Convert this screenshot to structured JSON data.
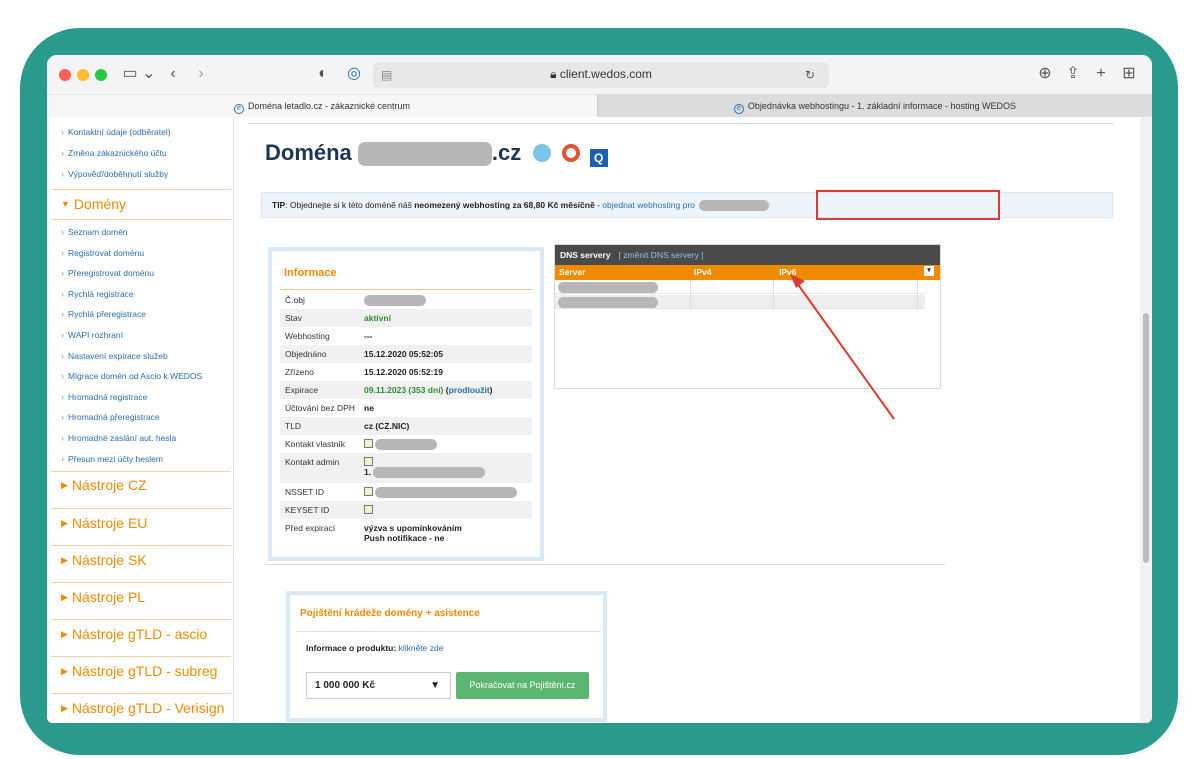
{
  "browser": {
    "url": "client.wedos.com",
    "tabs": [
      {
        "label": "Doména letadlo.cz - zákaznické centrum"
      },
      {
        "label": "Objednávka webhostingu - 1. základní informace - hosting WEDOS"
      }
    ]
  },
  "sidebar": {
    "top_links": [
      "Kontaktní údaje (odběratel)",
      "Změna zákaznického účtu",
      "Výpověď/doběhnutí služby"
    ],
    "domains_section": "Domény",
    "domain_links": [
      "Seznam domén",
      "Registrovat doménu",
      "Přeregistrovat doménu",
      "Rychlá registrace",
      "Rychlá přeregistrace",
      "WAPI rozhraní",
      "Nastavení expirace služeb",
      "Migrace domén od Ascio k WEDOS",
      "Hromadná registrace",
      "Hromadná přeregistrace",
      "Hromadné zaslání aut. hesla",
      "Přesun mezi účty heslem"
    ],
    "tool_sections": [
      "Nástroje CZ",
      "Nástroje EU",
      "Nástroje SK",
      "Nástroje PL",
      "Nástroje gTLD - ascio",
      "Nástroje gTLD - subreg",
      "Nástroje gTLD - Verisign"
    ]
  },
  "main": {
    "title_prefix": "Doména",
    "title_suffix": ".cz",
    "tip": {
      "lead": "TIP",
      "text": ": Objednejte si k této doméně náš ",
      "bold": "neomezený webhosting za 68,80 Kč měsíčně",
      "sep": " - ",
      "link": "objednat webhosting pro"
    },
    "info": {
      "title": "Informace",
      "rows": [
        {
          "k": "Č.obj",
          "v": ""
        },
        {
          "k": "Stav",
          "v": "aktivní"
        },
        {
          "k": "Webhosting",
          "v": "---"
        },
        {
          "k": "Objednáno",
          "v": "15.12.2020 05:52:05"
        },
        {
          "k": "Zřízeno",
          "v": "15.12.2020 05:52:19"
        },
        {
          "k": "Expirace",
          "v": "09.11.2023 (353 dní)",
          "link": "prodloužit"
        },
        {
          "k": "Účtování bez DPH",
          "v": "ne"
        },
        {
          "k": "TLD",
          "v": "cz (CZ.NIC)"
        },
        {
          "k": "Kontakt vlastník",
          "v": ""
        },
        {
          "k": "Kontakt admin",
          "v": "1."
        },
        {
          "k": "NSSET ID",
          "v": ""
        },
        {
          "k": "KEYSET ID",
          "v": ""
        },
        {
          "k": "Před expirací",
          "v": "výzva s upomínkováním",
          "v2": "Push notifikace - ne"
        }
      ]
    },
    "dns": {
      "title": "DNS servery",
      "change_link": "[ změnit DNS servery ]",
      "columns": [
        "Server",
        "IPv4",
        "IPv6"
      ]
    },
    "insurance": {
      "title": "Pojištění krádeže domény + asistence",
      "info_label": "Informace o produktu:",
      "info_link": "klikněte zde",
      "amount": "1 000 000 Kč",
      "button": "Pokračovat na Pojištění.cz"
    }
  }
}
